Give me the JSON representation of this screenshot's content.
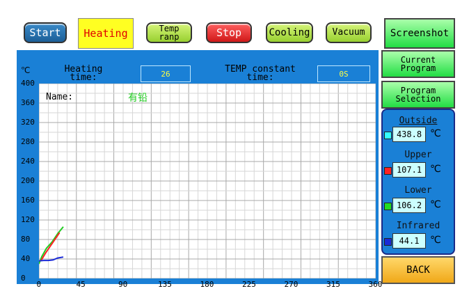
{
  "toolbar": {
    "start": "Start",
    "heating": "Heating",
    "ramp_line1": "Temp",
    "ramp_line2": "ranp",
    "stop": "Stop",
    "cooling": "Cooling",
    "vacuum": "Vacuum",
    "screenshot": "Screenshot"
  },
  "side": {
    "current_line1": "Current",
    "current_line2": "Program",
    "program_line1": "Program",
    "program_line2": "Selection",
    "back": "BACK"
  },
  "header": {
    "unit": "℃",
    "heating_time_line1": "Heating",
    "heating_time_line2": "time:",
    "heating_time_value": "26",
    "constant_line1": "TEMP constant",
    "constant_line2": "time:",
    "constant_value": "0S"
  },
  "chart_label": {
    "name_label": "Name:",
    "name_value": "有铅"
  },
  "chart_data": {
    "type": "line",
    "x_ticks": [
      "0",
      "45",
      "90",
      "135",
      "180",
      "225",
      "270",
      "315",
      "360"
    ],
    "y_ticks": [
      "0",
      "40",
      "80",
      "120",
      "160",
      "200",
      "240",
      "280",
      "320",
      "360",
      "400"
    ],
    "xlim": [
      0,
      360
    ],
    "ylim": [
      0,
      400
    ],
    "grid": true,
    "series": [
      {
        "color": "#22cc22",
        "values": [
          [
            0,
            30
          ],
          [
            3,
            45
          ],
          [
            8,
            62
          ],
          [
            14,
            75
          ],
          [
            20,
            92
          ],
          [
            26,
            106
          ]
        ]
      },
      {
        "color": "#ff2222",
        "values": [
          [
            2,
            36
          ],
          [
            7,
            52
          ],
          [
            12,
            66
          ],
          [
            17,
            80
          ],
          [
            22,
            94
          ]
        ]
      },
      {
        "color": "#1a2ad8",
        "values": [
          [
            0,
            36
          ],
          [
            5,
            37
          ],
          [
            10,
            37
          ],
          [
            15,
            38
          ],
          [
            20,
            42
          ],
          [
            26,
            44
          ]
        ]
      }
    ]
  },
  "temps": {
    "outside_label": "Outside",
    "outside_value": "438.8",
    "outside_color": "#33ffff",
    "upper_label": "Upper",
    "upper_value": "107.1",
    "upper_color": "#ff2222",
    "lower_label": "Lower",
    "lower_value": "106.2",
    "lower_color": "#22dd22",
    "infrared_label": "Infrared",
    "infrared_value": "44.1",
    "infrared_color": "#1a2ad8",
    "unit": "℃"
  }
}
